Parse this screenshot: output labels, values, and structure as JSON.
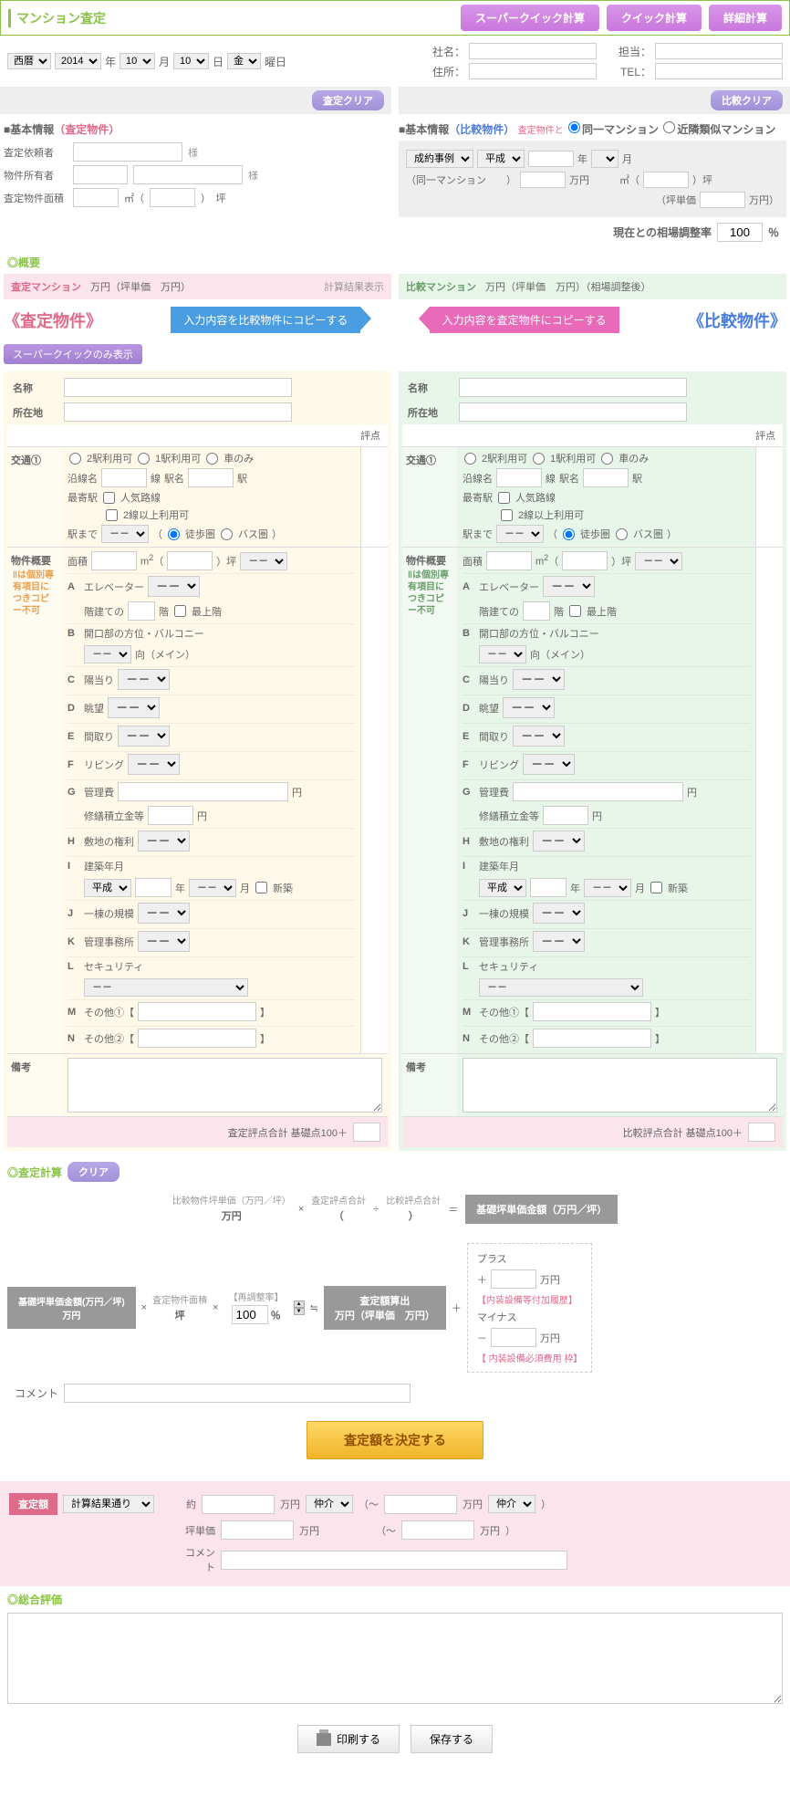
{
  "header": {
    "title": "マンション査定",
    "btn_super": "スーパークイック計算",
    "btn_quick": "クイック計算",
    "btn_detail": "詳細計算"
  },
  "date": {
    "era": "西暦",
    "year": "2014",
    "y_suf": "年",
    "month": "10",
    "m_suf": "月",
    "day": "10",
    "d_suf": "日",
    "dow": "金",
    "dow_suf": "曜日"
  },
  "company": {
    "name_lbl": "社名：",
    "addr_lbl": "住所：",
    "staff_lbl": "担当：",
    "tel_lbl": "TEL："
  },
  "clear": {
    "left": "査定クリア",
    "right": "比較クリア"
  },
  "basic": {
    "left_head_pre": "■基本情報",
    "left_head_em": "（査定物件）",
    "right_head_pre": "■基本情報",
    "right_head_em": "（比較物件）",
    "right_note": "査定物件と",
    "radio_same": "同一マンション",
    "radio_near": "近隣類似マンション",
    "client_lbl": "査定依頼者",
    "owner_lbl": "物件所有者",
    "area_lbl": "査定物件面積",
    "sama": "様",
    "m2": "㎡（",
    "tsubo": "）　坪",
    "deal_lbl": "成約事例",
    "era_opt": "平成",
    "y": "年",
    "mo": "月",
    "same_mansion": "（同一マンション　　）",
    "man": "万円",
    "man_p": "万円　　　㎡（",
    "tsubo2": "）坪",
    "tanka": "（坪単価",
    "manyen": "万円）",
    "rate_lbl": "現在との相場調整率",
    "rate_val": "100",
    "pct": "％"
  },
  "overview": {
    "head": "◎概要",
    "left_t": "査定マンション",
    "left_v": "万円（坪単価　万円）",
    "left_link": "計算結果表示",
    "right_t": "比較マンション",
    "right_v": "万円（坪単価　万円）（相場調整後）"
  },
  "copy": {
    "left_big": "《査定物件》",
    "right_big": "《比較物件》",
    "to_compare": "入力内容を比較物件にコピーする",
    "to_assess": "入力内容を査定物件にコピーする",
    "badge": "スーパークイックのみ表示"
  },
  "fields": {
    "name": "名称",
    "addr": "所在地",
    "score": "評点",
    "traffic": "交通①",
    "t_2sta": "2駅利用可",
    "t_1sta": "1駅利用可",
    "t_car": "車のみ",
    "line": "沿線名",
    "line_suf": "線",
    "sta": "駅名",
    "sta_suf": "駅",
    "nearest": "最寄駅",
    "popular": "人気路線",
    "multi": "2線以上利用可",
    "to_sta": "駅まで",
    "dash": "－－",
    "walk": "徒歩圏",
    "bus": "バス圏",
    "outline": "物件概要",
    "note_y": "‖は個別専有項目につきコピー不可",
    "area": "面積",
    "m2u": "m",
    "tsubo_u": "）坪",
    "a": "A",
    "elev": "エレベーター",
    "floor_pre": "階建ての",
    "floor_suf": "階",
    "top": "最上階",
    "b": "B",
    "opening": "開口部の方位・バルコニー",
    "dir": "向（メイン）",
    "c": "C",
    "sun": "陽当り",
    "d": "D",
    "view": "眺望",
    "e": "E",
    "layout": "間取り",
    "f": "F",
    "living": "リビング",
    "g": "G",
    "mgmt": "管理費",
    "yen": "円",
    "reserve": "修繕積立金等",
    "h": "H",
    "land": "敷地の権利",
    "i": "I",
    "built": "建築年月",
    "heisei": "平成",
    "new": "新築",
    "j": "J",
    "scale": "一棟の規模",
    "k": "K",
    "office": "管理事務所",
    "l": "L",
    "security": "セキュリティ",
    "m": "M",
    "other1": "その他①【",
    "br": "】",
    "n": "N",
    "other2": "その他②【",
    "remarks": "備考",
    "total_l": "査定評点合計 基礎点100＋",
    "total_r": "比較評点合計 基礎点100＋"
  },
  "calc": {
    "head": "◎査定計算",
    "clear": "クリア",
    "f1_a": "比較物件坪単価（万円／坪）",
    "f1_av": "万円",
    "f1_b": "査定評点合計",
    "f1_c": "比較評点合計",
    "mult": "×",
    "paren_l": "（",
    "div": "÷",
    "paren_r": "）",
    "eq": "＝",
    "f1_r": "基礎坪単価金額（万円／坪）",
    "f2_a": "基礎坪単価金額(万円／坪)",
    "f2_av": "万円",
    "f2_b": "査定物件面積",
    "f2_bv": "坪",
    "f2_c": "【再調整率】",
    "f2_cv": "100",
    "f2_cpct": "％",
    "approx": "≒",
    "f2_r": "査定額算出",
    "f2_rv": "万円（坪単価　万円）",
    "plus": "＋",
    "adj_plus": "プラス",
    "adj_plus_note": "【内装設備等付加履歴】",
    "minus": "－",
    "adj_minus": "マイナス",
    "adj_minus_note": "【 内装設備必須費用 枠】",
    "comment": "コメント",
    "decide": "査定額を決定する"
  },
  "final": {
    "badge": "査定額",
    "sel": "計算結果通り",
    "about": "約",
    "man": "万円",
    "chukai": "仲介",
    "tilde": "（～",
    "tanka": "坪単価",
    "comment": "コメント"
  },
  "overall": {
    "head": "◎総合評価"
  },
  "footer": {
    "print": "印刷する",
    "save": "保存する"
  }
}
